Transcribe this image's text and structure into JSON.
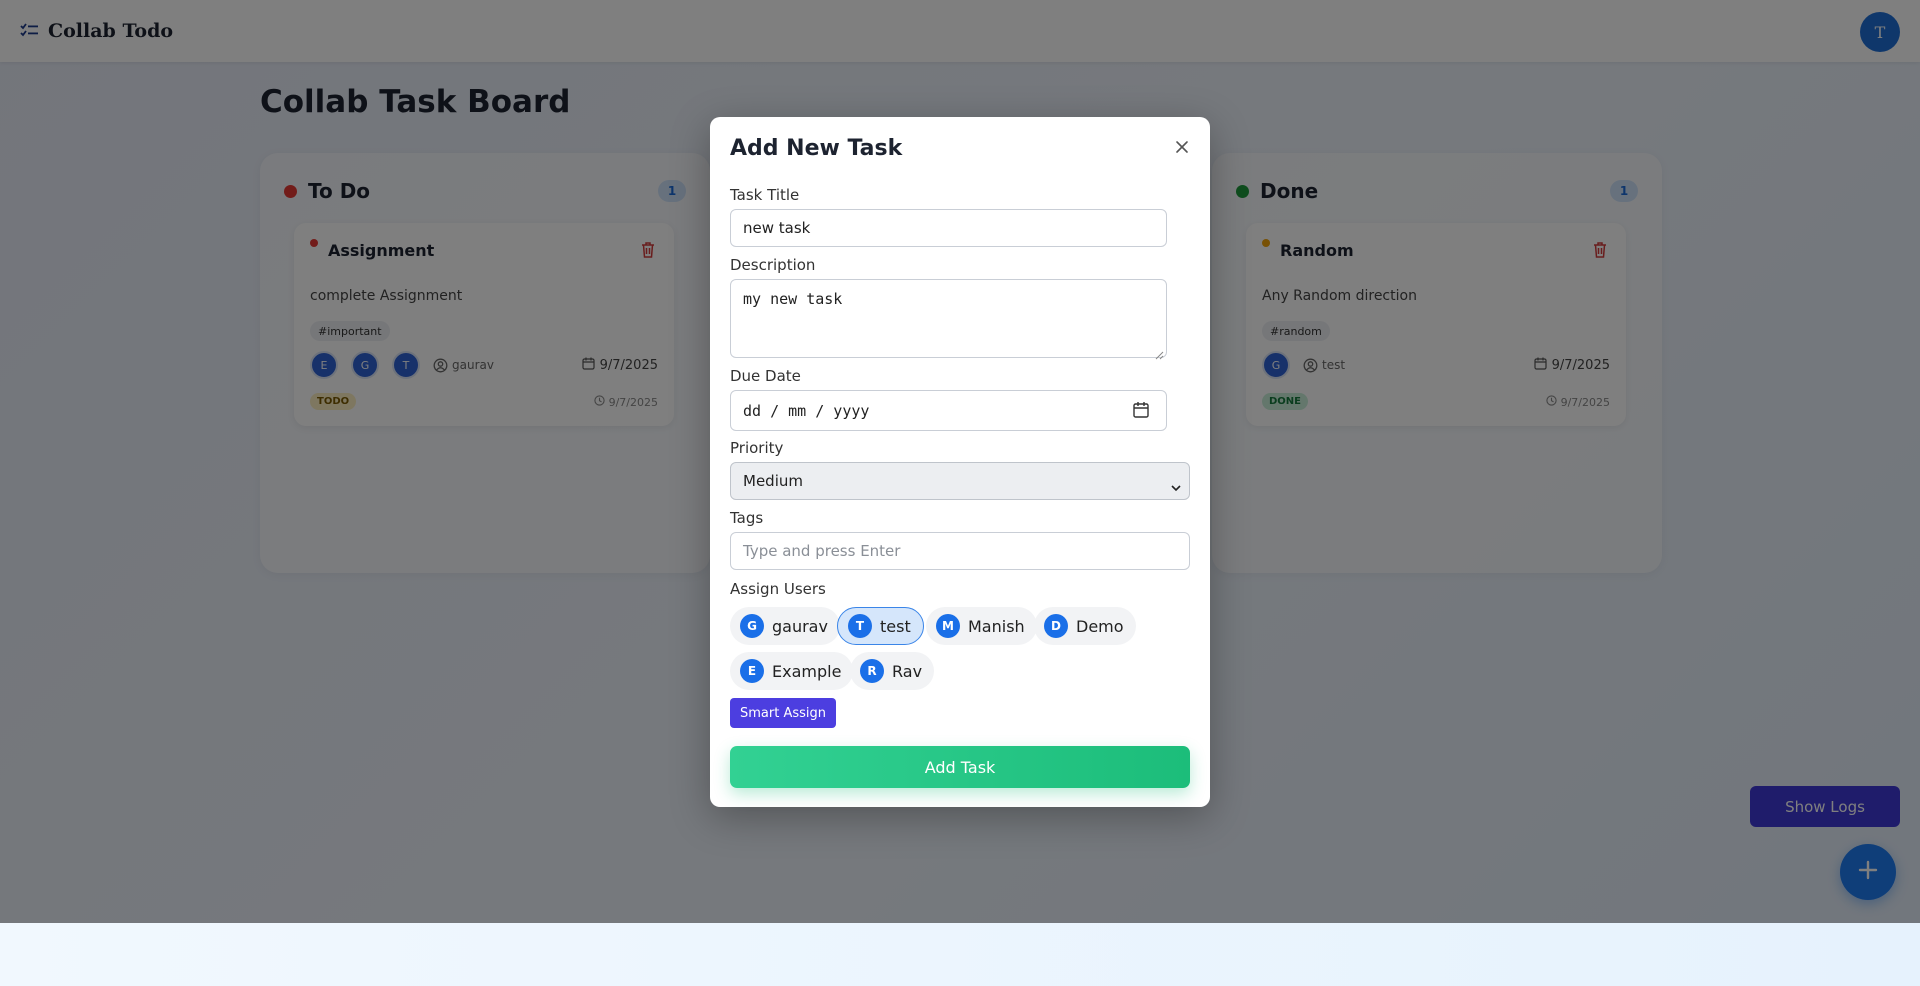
{
  "app": {
    "title": "Collab Todo",
    "user_initial": "T"
  },
  "board": {
    "title": "Collab Task Board",
    "columns": [
      {
        "name": "To Do",
        "count": "1",
        "dot_color": "#e53935",
        "card": {
          "title": "Assignment",
          "priority_color": "#e53935",
          "description": "complete Assignment",
          "tag": "#important",
          "assignees": [
            "E",
            "G",
            "T"
          ],
          "creator": "gaurav",
          "due": "9/7/2025",
          "status": "TODO",
          "created": "9/7/2025"
        }
      },
      {
        "name": "Done",
        "count": "1",
        "dot_color": "#1e9a3c",
        "card": {
          "title": "Random",
          "priority_color": "#f0a30a",
          "description": "Any Random direction",
          "tag": "#random",
          "assignees": [
            "G"
          ],
          "creator": "test",
          "due": "9/7/2025",
          "status": "DONE",
          "created": "9/7/2025"
        }
      }
    ]
  },
  "modal": {
    "title": "Add New Task",
    "task_title_label": "Task Title",
    "task_title_value": "new task",
    "description_label": "Description",
    "description_value": "my new task",
    "due_date_label": "Due Date",
    "due_date_placeholder": "dd / mm / yyyy",
    "priority_label": "Priority",
    "priority_value": "Medium",
    "tags_label": "Tags",
    "tags_placeholder": "Type and press Enter",
    "assign_label": "Assign Users",
    "users": [
      {
        "initial": "G",
        "name": "gaurav",
        "selected": false
      },
      {
        "initial": "T",
        "name": "test",
        "selected": true
      },
      {
        "initial": "M",
        "name": "Manish",
        "selected": false
      },
      {
        "initial": "D",
        "name": "Demo",
        "selected": false
      },
      {
        "initial": "E",
        "name": "Example",
        "selected": false
      },
      {
        "initial": "R",
        "name": "Rav",
        "selected": false
      }
    ],
    "smart_assign_label": "Smart Assign",
    "add_task_label": "Add Task"
  },
  "actions": {
    "show_logs_label": "Show Logs"
  },
  "colors": {
    "accent": "#1f7cf2",
    "smart_assign": "#4c3ee0",
    "add_task": "#1cbd7a",
    "show_logs": "#3f38d6"
  }
}
